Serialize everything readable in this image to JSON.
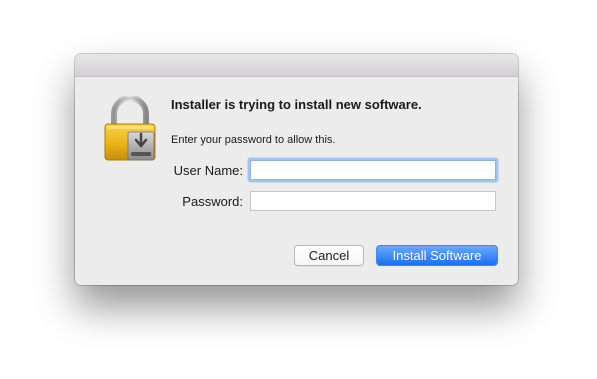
{
  "dialog": {
    "heading": "Installer is trying to install new software.",
    "subtext": "Enter your password to allow this.",
    "username": {
      "label": "User Name:",
      "value": "",
      "focused": true
    },
    "password": {
      "label": "Password:",
      "value": ""
    },
    "buttons": {
      "cancel_label": "Cancel",
      "install_label": "Install Software"
    },
    "icon": "lock-with-installer-icon"
  },
  "colors": {
    "accent": "#2f7cf6",
    "focus_ring": "#a3c3f0",
    "lock_gold": "#f0b400",
    "dialog_bg": "#ececec"
  }
}
